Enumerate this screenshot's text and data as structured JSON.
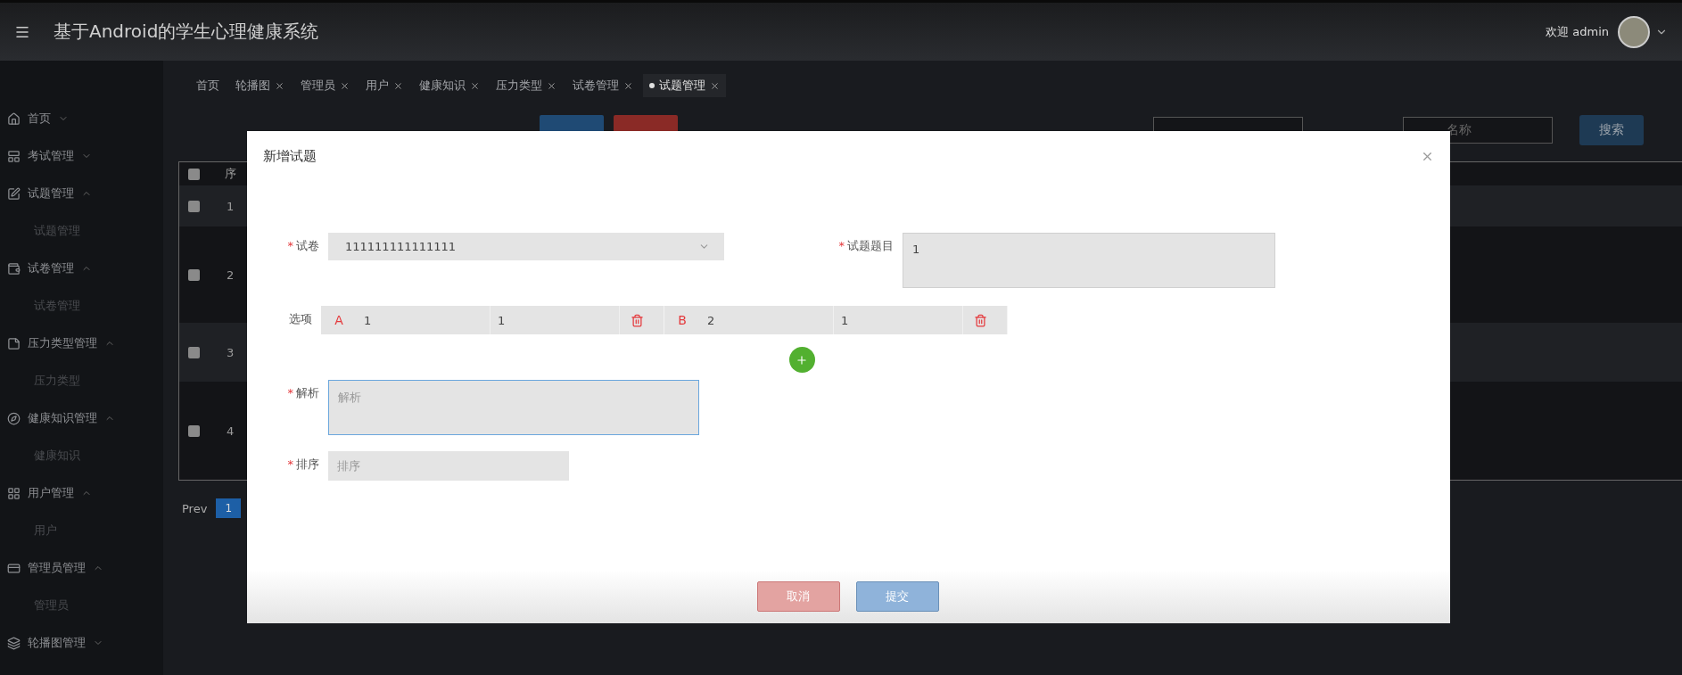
{
  "header": {
    "title": "基于Android的学生心理健康系统",
    "welcome": "欢迎 admin"
  },
  "sidebar": {
    "items": [
      {
        "label": "首页",
        "expanded": false
      },
      {
        "label": "考试管理",
        "expanded": false
      },
      {
        "label": "试题管理",
        "expanded": true,
        "children": [
          {
            "label": "试题管理"
          }
        ]
      },
      {
        "label": "试卷管理",
        "expanded": true,
        "children": [
          {
            "label": "试卷管理"
          }
        ]
      },
      {
        "label": "压力类型管理",
        "expanded": true,
        "children": [
          {
            "label": "压力类型"
          }
        ]
      },
      {
        "label": "健康知识管理",
        "expanded": true,
        "children": [
          {
            "label": "健康知识"
          }
        ]
      },
      {
        "label": "用户管理",
        "expanded": true,
        "children": [
          {
            "label": "用户"
          }
        ]
      },
      {
        "label": "管理员管理",
        "expanded": true,
        "children": [
          {
            "label": "管理员"
          }
        ]
      },
      {
        "label": "轮播图管理",
        "expanded": false
      }
    ]
  },
  "tabs": [
    {
      "label": "首页",
      "selected": false,
      "closable": false
    },
    {
      "label": "轮播图",
      "selected": false,
      "closable": true
    },
    {
      "label": "管理员",
      "selected": false,
      "closable": true
    },
    {
      "label": "用户",
      "selected": false,
      "closable": true
    },
    {
      "label": "健康知识",
      "selected": false,
      "closable": true
    },
    {
      "label": "压力类型",
      "selected": false,
      "closable": true
    },
    {
      "label": "试卷管理",
      "selected": false,
      "closable": true
    },
    {
      "label": "试题管理",
      "selected": true,
      "closable": true
    }
  ],
  "toolbar": {
    "buttons": [
      {
        "kind": "add"
      },
      {
        "kind": "delete"
      }
    ],
    "search": {
      "placeholder": "名称"
    },
    "search_button": "搜索"
  },
  "table": {
    "all_checked": false,
    "column_2": "序",
    "rows": [
      {
        "number": "1",
        "checked": false,
        "shaded": true
      },
      {
        "number": "2",
        "checked": false,
        "shaded": false
      },
      {
        "number": "3",
        "checked": false,
        "shaded": true
      },
      {
        "number": "4",
        "checked": false,
        "shaded": false
      }
    ]
  },
  "pagination": {
    "prev": "Prev",
    "pages": [
      {
        "label": "1",
        "selected": true
      }
    ]
  },
  "modal": {
    "title": "新增试题",
    "paper": {
      "label": "试卷",
      "required_mark": "*",
      "value": "111111111111111"
    },
    "question": {
      "label": "试题题目",
      "required_mark": "*",
      "value": "1"
    },
    "options": {
      "label": "选项",
      "items": [
        {
          "letter": "A",
          "content": "1",
          "score": "1"
        },
        {
          "letter": "B",
          "content": "2",
          "score": "1"
        }
      ]
    },
    "analysis": {
      "label": "解析",
      "required_mark": "*",
      "placeholder": "解析",
      "focused": true
    },
    "order": {
      "label": "排序",
      "required_mark": "*",
      "placeholder": "排序"
    },
    "cancel": "取消",
    "submit": "提交"
  }
}
